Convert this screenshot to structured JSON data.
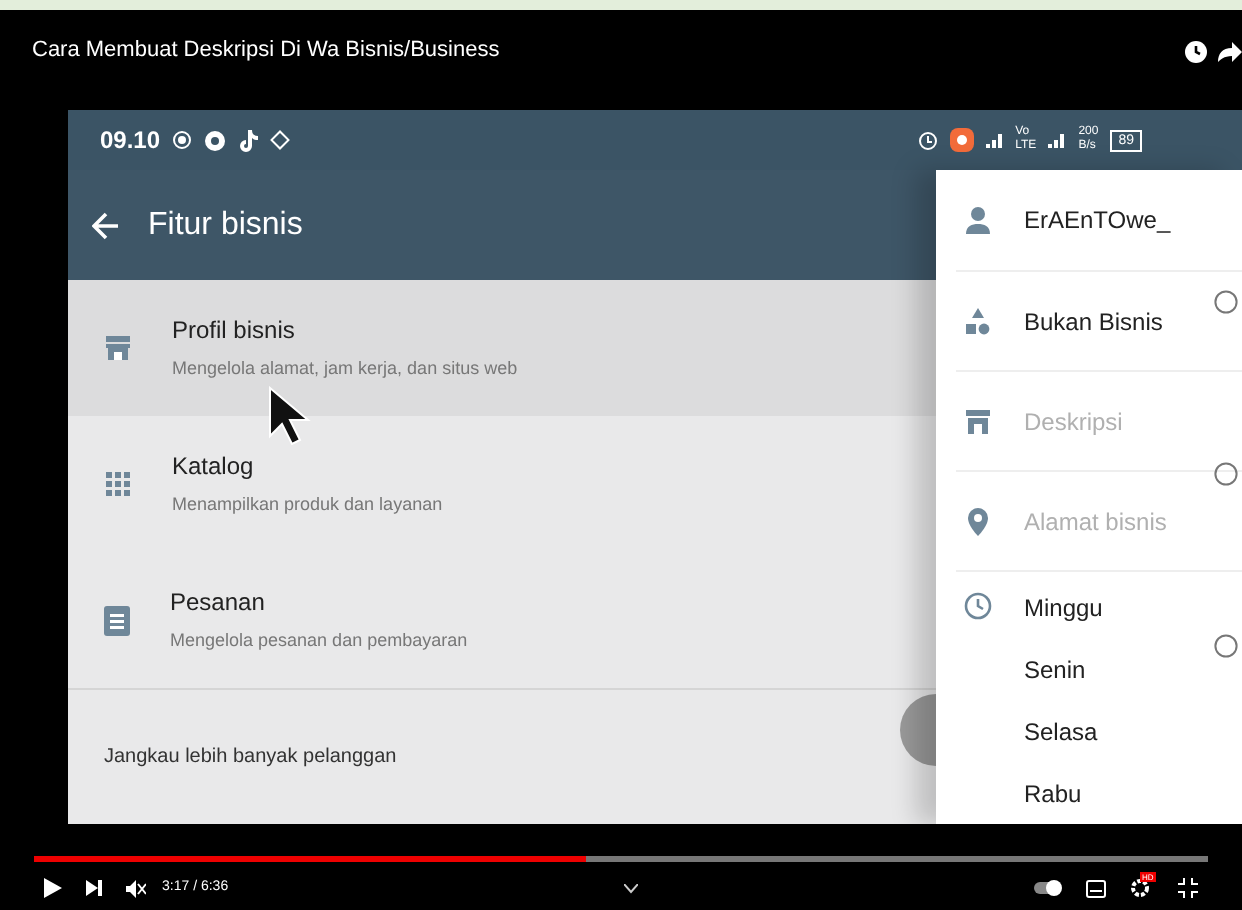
{
  "video": {
    "title": "Cara Membuat Deskripsi Di Wa Bisnis/Business"
  },
  "status_bar": {
    "time": "09.10",
    "network_top": "Vo",
    "network_bottom": "LTE",
    "speed_value": "200",
    "speed_unit": "B/s",
    "battery": "89"
  },
  "header": {
    "title": "Fitur bisnis"
  },
  "items": [
    {
      "title": "Profil bisnis",
      "subtitle": "Mengelola alamat, jam kerja, dan situs web",
      "selected": true
    },
    {
      "title": "Katalog",
      "subtitle": "Menampilkan produk dan layanan",
      "selected": false
    },
    {
      "title": "Pesanan",
      "subtitle": "Mengelola pesanan dan pembayaran",
      "selected": false
    }
  ],
  "section_label": "Jangkau lebih banyak pelanggan",
  "profile_rows": [
    {
      "kind": "field",
      "text": "ErAEnTOwe_",
      "muted": false
    },
    {
      "kind": "field",
      "text": "Bukan Bisnis",
      "muted": false
    },
    {
      "kind": "field",
      "text": "Deskripsi",
      "muted": true
    },
    {
      "kind": "field",
      "text": "Alamat bisnis",
      "muted": true
    },
    {
      "kind": "hours",
      "days": [
        "Minggu",
        "Senin",
        "Selasa",
        "Rabu"
      ]
    }
  ],
  "player": {
    "level": 0.47,
    "time": "3:17 / 6:36",
    "hd": "HD"
  }
}
